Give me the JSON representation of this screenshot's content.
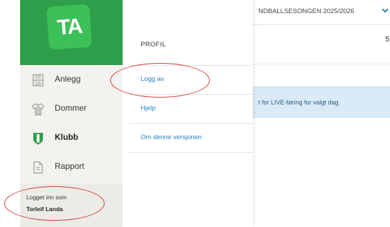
{
  "brand": {
    "logo_text": "TA",
    "color": "#2f9e4a"
  },
  "sidebar": {
    "items": [
      {
        "label": "Anlegg",
        "icon": "facility-icon"
      },
      {
        "label": "Dommer",
        "icon": "referee-shirt-icon"
      },
      {
        "label": "Klubb",
        "icon": "shield-icon",
        "active": true
      },
      {
        "label": "Rapport",
        "icon": "document-icon"
      }
    ],
    "login": {
      "prefix": "Logget inn som",
      "user": "Torleif Landa"
    }
  },
  "profile_menu": {
    "heading": "PROFIL",
    "items": [
      "Logg av",
      "Hjelp",
      "Om denne versjonen"
    ]
  },
  "main": {
    "season": "NDBALLSESONGEN 2025/2026",
    "cut_text": "5",
    "info_text": "t for LIVE-føring for valgt dag."
  },
  "colors": {
    "accent": "#2f9e4a",
    "link": "#2a7fbf",
    "annotation": "#d63a3a",
    "info_bg": "#dbeaf7"
  }
}
